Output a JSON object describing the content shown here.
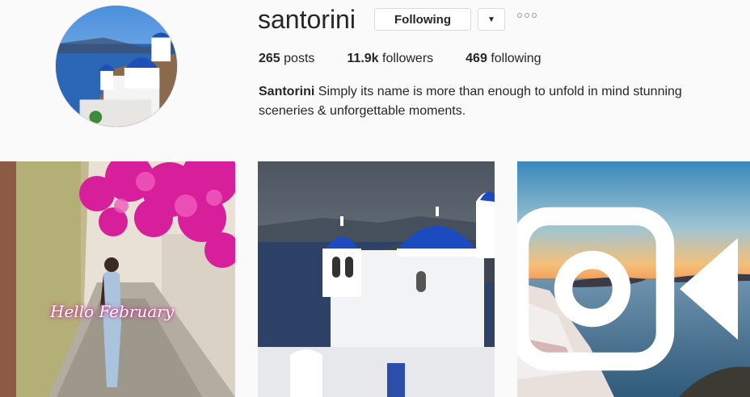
{
  "profile": {
    "username": "santorini",
    "follow_label": "Following",
    "dropdown_icon": "caret-down-icon",
    "options_icon": "more-options-icon"
  },
  "stats": {
    "posts_count": "265",
    "posts_label": "posts",
    "followers_count": "11.9k",
    "followers_label": "followers",
    "following_count": "469",
    "following_label": "following"
  },
  "bio": {
    "name": "Santorini",
    "text": "Simply its name is more than enough to unfold in mind stunning sceneries & unforgettable moments."
  },
  "posts": [
    {
      "overlay_text": "Hello February"
    },
    {},
    {
      "badge_icon": "video-camera-icon"
    }
  ]
}
